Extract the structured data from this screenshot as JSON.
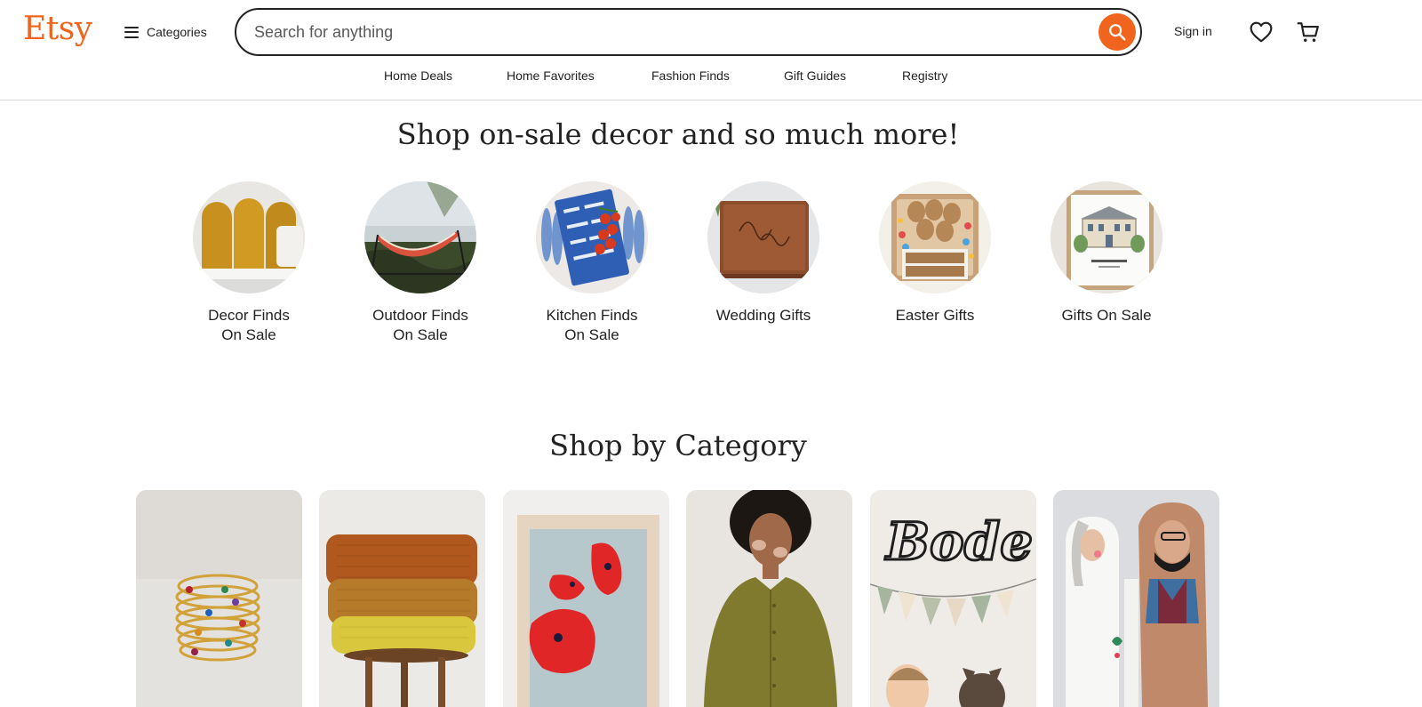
{
  "header": {
    "logo": "Etsy",
    "categories_label": "Categories",
    "search_placeholder": "Search for anything",
    "sign_in": "Sign in"
  },
  "nav": {
    "links": [
      "Home Deals",
      "Home Favorites",
      "Fashion Finds",
      "Gift Guides",
      "Registry"
    ]
  },
  "promo": {
    "heading": "Shop on-sale decor and so much more!",
    "items": [
      {
        "line1": "Decor Finds",
        "line2": "On Sale",
        "image": "mustard velvet headboard"
      },
      {
        "line1": "Outdoor Finds",
        "line2": "On Sale",
        "image": "striped hammock by lake"
      },
      {
        "line1": "Kitchen Finds",
        "line2": "On Sale",
        "image": "blue tea towel with tomatoes"
      },
      {
        "line1": "Wedding Gifts",
        "line2": "",
        "image": "engraved wooden guest book"
      },
      {
        "line1": "Easter Gifts",
        "line2": "",
        "image": "happy easter wooden box"
      },
      {
        "line1": "Gifts On Sale",
        "line2": "",
        "image": "framed house illustration"
      }
    ]
  },
  "category": {
    "heading": "Shop by Category",
    "cards": [
      {
        "image": "stacked gold birthstone rings"
      },
      {
        "image": "folded knit blankets on stool"
      },
      {
        "image": "red poppy art print"
      },
      {
        "image": "woman in olive linen shirt"
      },
      {
        "image": "Bode name sign nursery",
        "sign_text": "Bode"
      },
      {
        "image": "wooden wedding couple figures"
      }
    ]
  },
  "colors": {
    "brand": "#f1641e",
    "text": "#222222",
    "border": "#d6d6d6"
  }
}
